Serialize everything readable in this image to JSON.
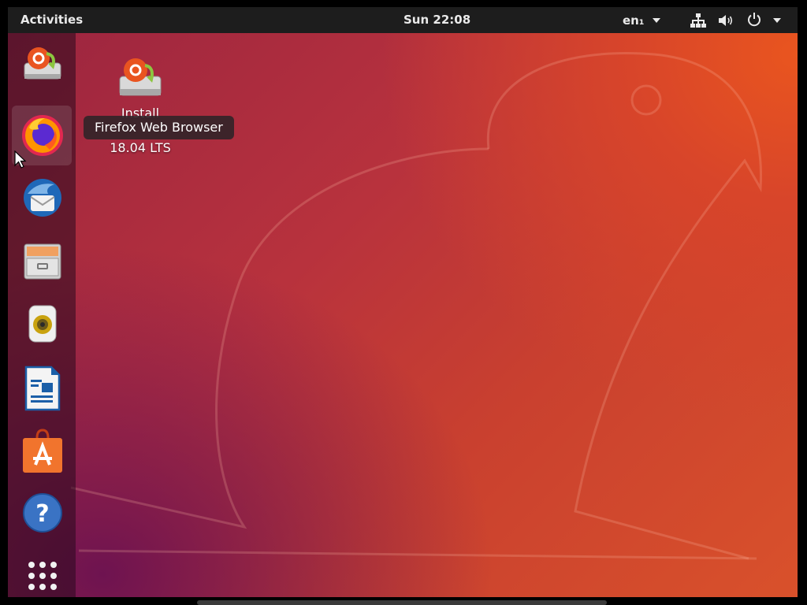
{
  "topbar": {
    "activities_label": "Activities",
    "clock": "Sun 22:08",
    "language": "en₁",
    "icons": [
      "network-icon",
      "volume-icon",
      "power-icon",
      "chevron-down-icon"
    ]
  },
  "dock": {
    "items": [
      {
        "name": "install-ubuntu",
        "icon": "install-disk-icon"
      },
      {
        "name": "firefox",
        "icon": "firefox-icon",
        "active": true
      },
      {
        "name": "thunderbird",
        "icon": "thunderbird-icon"
      },
      {
        "name": "files",
        "icon": "file-cabinet-icon"
      },
      {
        "name": "rhythmbox",
        "icon": "speaker-icon"
      },
      {
        "name": "libreoffice-writer",
        "icon": "document-icon"
      },
      {
        "name": "ubuntu-software",
        "icon": "shopping-bag-icon"
      },
      {
        "name": "help",
        "icon": "help-icon"
      },
      {
        "name": "show-applications",
        "icon": "app-grid-icon"
      }
    ]
  },
  "desktop": {
    "icon_label_line1": "Install",
    "icon_label_line3": "18.04 LTS",
    "tooltip": "Firefox Web Browser"
  },
  "colors": {
    "topbar": "#1d1d1d",
    "wallpaper_orange": "#e9551f",
    "wallpaper_purple": "#6e1350",
    "ubuntu_orange": "#e95420"
  }
}
